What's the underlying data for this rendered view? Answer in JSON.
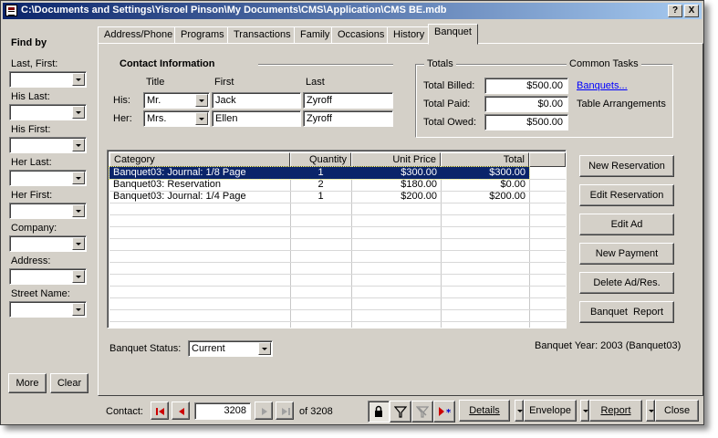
{
  "window": {
    "title": "C:\\Documents and Settings\\Yisroel Pinson\\My Documents\\CMS\\Application\\CMS BE.mdb",
    "help_label": "?",
    "close_label": "X"
  },
  "find_by": {
    "heading": "Find by",
    "fields": [
      {
        "label": "Last, First:",
        "value": ""
      },
      {
        "label": "His Last:",
        "value": ""
      },
      {
        "label": "His First:",
        "value": ""
      },
      {
        "label": "Her Last:",
        "value": ""
      },
      {
        "label": "Her First:",
        "value": ""
      },
      {
        "label": "Company:",
        "value": ""
      },
      {
        "label": "Address:",
        "value": ""
      },
      {
        "label": "Street Name:",
        "value": ""
      }
    ],
    "more_label": "More",
    "clear_label": "Clear"
  },
  "tabs": [
    {
      "label": "Address/Phone"
    },
    {
      "label": "Programs"
    },
    {
      "label": "Transactions"
    },
    {
      "label": "Family"
    },
    {
      "label": "Occasions"
    },
    {
      "label": "History"
    },
    {
      "label": "Banquet"
    }
  ],
  "contact": {
    "heading": "Contact Information",
    "col_title": "Title",
    "col_first": "First",
    "col_last": "Last",
    "his_label": "His:",
    "her_label": "Her:",
    "his_title": "Mr.",
    "his_first": "Jack",
    "his_last": "Zyroff",
    "her_title": "Mrs.",
    "her_first": "Ellen",
    "her_last": "Zyroff"
  },
  "totals": {
    "heading": "Totals",
    "billed_label": "Total Billed:",
    "billed": "$500.00",
    "paid_label": "Total Paid:",
    "paid": "$0.00",
    "owed_label": "Total Owed:",
    "owed": "$500.00"
  },
  "common_tasks": {
    "heading": "Common Tasks",
    "banquets_link": "Banquets...",
    "table_arrangements": "Table Arrangements"
  },
  "grid": {
    "headers": [
      "Category",
      "Quantity",
      "Unit Price",
      "Total"
    ],
    "rows": [
      {
        "category": "Banquet03: Journal: 1/8 Page",
        "quantity": "1",
        "unit_price": "$300.00",
        "total": "$300.00"
      },
      {
        "category": "Banquet03: Reservation",
        "quantity": "2",
        "unit_price": "$180.00",
        "total": "$0.00"
      },
      {
        "category": "Banquet03: Journal: 1/4 Page",
        "quantity": "1",
        "unit_price": "$200.00",
        "total": "$200.00"
      }
    ]
  },
  "actions": {
    "new_reservation": "New Reservation",
    "edit_reservation": "Edit Reservation",
    "edit_ad": "Edit Ad",
    "new_payment": "New Payment",
    "delete": "Delete Ad/Res.",
    "report": "Banquet  Report"
  },
  "banquet": {
    "status_label": "Banquet Status:",
    "status_value": "Current",
    "year_text": "Banquet Year: 2003 (Banquet03)"
  },
  "footer": {
    "contact_label": "Contact:",
    "record_number": "3208",
    "of_text": "of 3208",
    "details_label": "Details",
    "envelope_label": "Envelope",
    "report_label": "Report",
    "close_label": "Close"
  },
  "colors": {
    "title_bar_start": "#0a246a",
    "title_bar_end": "#a6caf0",
    "face": "#d4d0c8",
    "selection": "#0a246a",
    "link": "#0000ff",
    "nav_red": "#cc0000"
  }
}
